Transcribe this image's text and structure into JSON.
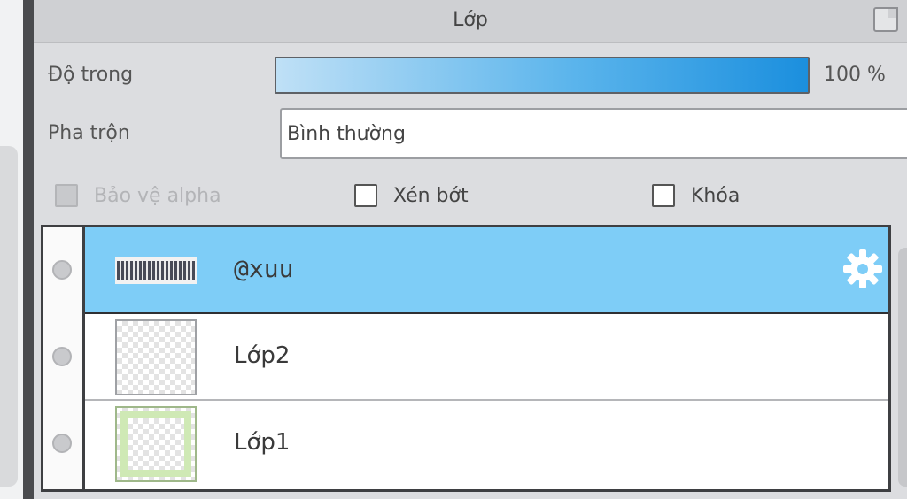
{
  "panel": {
    "title": "Lớp"
  },
  "opacity": {
    "label": "Độ trong",
    "value_text": "100 %",
    "fraction": 1.0
  },
  "blend": {
    "label": "Pha trộn",
    "value": "Bình thường"
  },
  "options": {
    "protect_alpha": {
      "label": "Bảo vệ alpha",
      "checked": false,
      "disabled": true
    },
    "clipping": {
      "label": "Xén bớt",
      "checked": false
    },
    "lock": {
      "label": "Khóa",
      "checked": false
    }
  },
  "layers": [
    {
      "name": "@xuu",
      "selected": true,
      "kind": "text"
    },
    {
      "name": "Lớp2",
      "selected": false,
      "kind": "raster"
    },
    {
      "name": "Lớp1",
      "selected": false,
      "kind": "frame"
    }
  ],
  "colors": {
    "selected_row": "#7ecdf7",
    "opacity_fill": "#1b8fde"
  }
}
